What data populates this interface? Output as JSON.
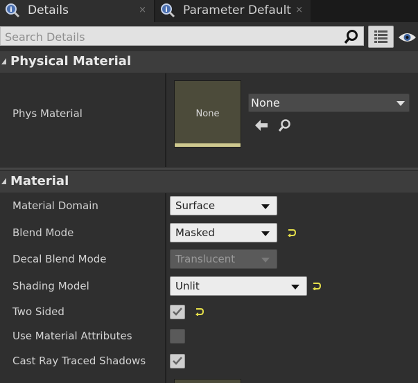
{
  "tabs": [
    {
      "label": "Details",
      "close": "×"
    },
    {
      "label": "Parameter Default",
      "close": "×"
    }
  ],
  "search": {
    "placeholder": "Search Details"
  },
  "categories": {
    "physical": "Physical Material",
    "material": "Material"
  },
  "phys_material": {
    "label": "Phys Material",
    "thumbnail_text": "None",
    "selected": "None"
  },
  "properties": {
    "material_domain": {
      "label": "Material Domain",
      "value": "Surface"
    },
    "blend_mode": {
      "label": "Blend Mode",
      "value": "Masked"
    },
    "decal_blend_mode": {
      "label": "Decal Blend Mode",
      "value": "Translucent"
    },
    "shading_model": {
      "label": "Shading Model",
      "value": "Unlit"
    },
    "two_sided": {
      "label": "Two Sided",
      "checked": true
    },
    "use_material_attributes": {
      "label": "Use Material Attributes",
      "checked": false
    },
    "cast_ray_traced_shadows": {
      "label": "Cast Ray Traced Shadows",
      "checked": true
    }
  },
  "colors": {
    "reset_yellow": "#e6e04a",
    "thumb_accent": "#cfc98f",
    "panel_bg": "#2f2f2f"
  }
}
